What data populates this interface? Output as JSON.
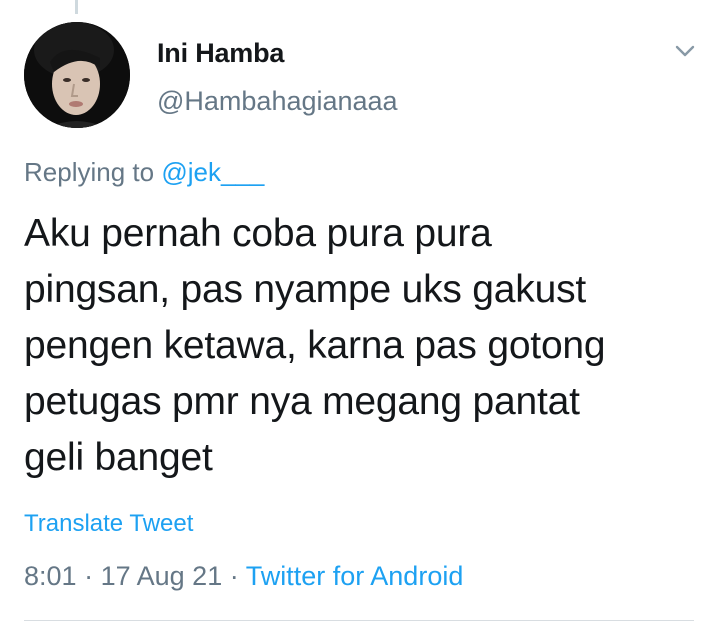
{
  "tweet": {
    "display_name": "Ini Hamba",
    "handle": "@Hambahagianaaa",
    "avatar_icon": "user-avatar-photo",
    "menu_icon": "chevron-down-icon",
    "replying_prefix": "Replying to",
    "replying_to": "@jek___",
    "text_lines": [
      "Aku pernah coba pura pura",
      "pingsan, pas nyampe uks gakust",
      "pengen ketawa, karna pas gotong",
      "petugas pmr nya megang pantat",
      "geli banget"
    ],
    "translate_label": "Translate Tweet",
    "time": "8:01",
    "separator": "·",
    "date": "17 Aug 21",
    "source": "Twitter for Android"
  },
  "colors": {
    "link": "#1da1f2",
    "secondary_text": "#657786",
    "primary_text": "#14171a",
    "divider": "#d8dde1"
  }
}
